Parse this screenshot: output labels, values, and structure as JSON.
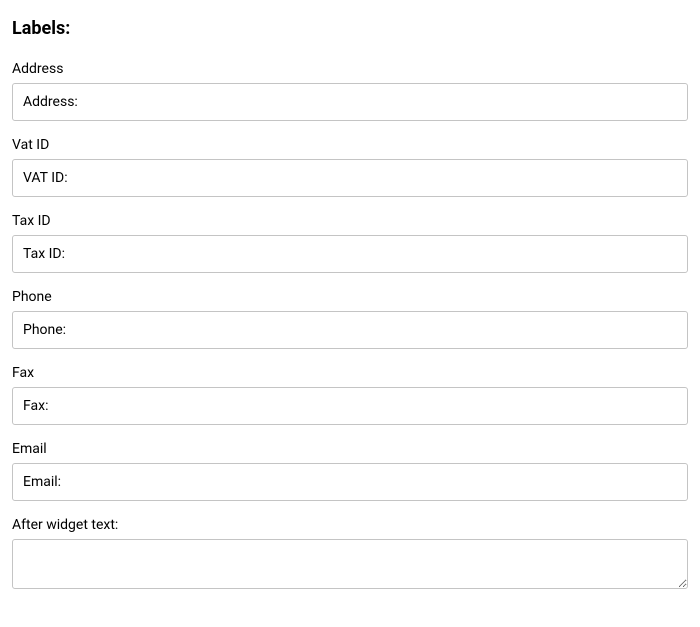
{
  "section": {
    "title": "Labels:"
  },
  "fields": {
    "address": {
      "label": "Address",
      "value": "Address:"
    },
    "vat_id": {
      "label": "Vat ID",
      "value": "VAT ID:"
    },
    "tax_id": {
      "label": "Tax ID",
      "value": "Tax ID:"
    },
    "phone": {
      "label": "Phone",
      "value": "Phone:"
    },
    "fax": {
      "label": "Fax",
      "value": "Fax:"
    },
    "email": {
      "label": "Email",
      "value": "Email:"
    },
    "after_widget_text": {
      "label": "After widget text:",
      "value": ""
    }
  }
}
